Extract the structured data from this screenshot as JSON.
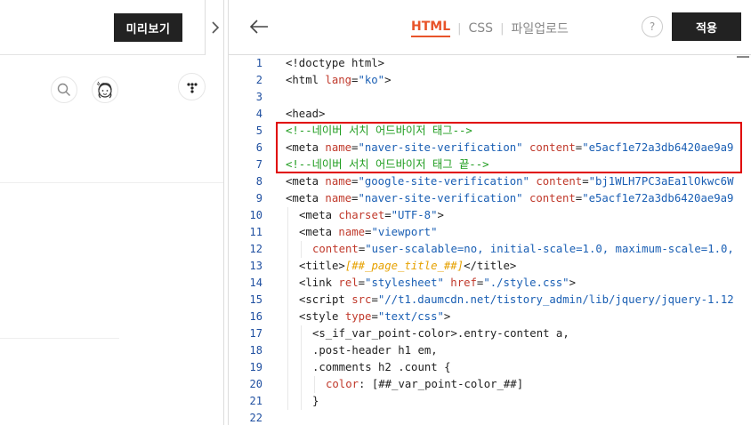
{
  "left": {
    "preview_label": "미리보기"
  },
  "header": {
    "tabs": [
      "HTML",
      "CSS",
      "파일업로드"
    ],
    "help_label": "?",
    "apply_label": "적용"
  },
  "code_lines": [
    {
      "n": "1",
      "indent": 0,
      "parts": [
        [
          "t-tag",
          "<!doctype html>"
        ]
      ]
    },
    {
      "n": "2",
      "indent": 0,
      "parts": [
        [
          "t-tag",
          "<html "
        ],
        [
          "t-attr",
          "lang"
        ],
        [
          "t-tag",
          "="
        ],
        [
          "t-val",
          "\"ko\""
        ],
        [
          "t-tag",
          ">"
        ]
      ]
    },
    {
      "n": "3",
      "indent": 0,
      "parts": []
    },
    {
      "n": "4",
      "indent": 0,
      "parts": [
        [
          "t-tag",
          "<head>"
        ]
      ]
    },
    {
      "n": "5",
      "indent": 0,
      "parts": [
        [
          "t-cmt",
          "<!--네이버 서치 어드바이저 태그-->"
        ]
      ]
    },
    {
      "n": "6",
      "indent": 0,
      "parts": [
        [
          "t-tag",
          "<meta "
        ],
        [
          "t-attr",
          "name"
        ],
        [
          "t-tag",
          "="
        ],
        [
          "t-val",
          "\"naver-site-verification\""
        ],
        [
          "t-tag",
          " "
        ],
        [
          "t-attr",
          "content"
        ],
        [
          "t-tag",
          "="
        ],
        [
          "t-val",
          "\"e5acf1e72a3db6420ae9a9"
        ]
      ]
    },
    {
      "n": "7",
      "indent": 0,
      "parts": [
        [
          "t-cmt",
          "<!--네이버 서치 어드바이저 태그 끝-->"
        ]
      ]
    },
    {
      "n": "8",
      "indent": 0,
      "parts": [
        [
          "t-tag",
          "<meta "
        ],
        [
          "t-attr",
          "name"
        ],
        [
          "t-tag",
          "="
        ],
        [
          "t-val",
          "\"google-site-verification\""
        ],
        [
          "t-tag",
          " "
        ],
        [
          "t-attr",
          "content"
        ],
        [
          "t-tag",
          "="
        ],
        [
          "t-val",
          "\"bj1WLH7PC3aEa1lOkwc6W"
        ]
      ]
    },
    {
      "n": "9",
      "indent": 0,
      "parts": [
        [
          "t-tag",
          "<meta "
        ],
        [
          "t-attr",
          "name"
        ],
        [
          "t-tag",
          "="
        ],
        [
          "t-val",
          "\"naver-site-verification\""
        ],
        [
          "t-tag",
          " "
        ],
        [
          "t-attr",
          "content"
        ],
        [
          "t-tag",
          "="
        ],
        [
          "t-val",
          "\"e5acf1e72a3db6420ae9a9"
        ]
      ]
    },
    {
      "n": "10",
      "indent": 1,
      "parts": [
        [
          "t-tag",
          "<meta "
        ],
        [
          "t-attr",
          "charset"
        ],
        [
          "t-tag",
          "="
        ],
        [
          "t-val",
          "\"UTF-8\""
        ],
        [
          "t-tag",
          ">"
        ]
      ]
    },
    {
      "n": "11",
      "indent": 1,
      "parts": [
        [
          "t-tag",
          "<meta "
        ],
        [
          "t-attr",
          "name"
        ],
        [
          "t-tag",
          "="
        ],
        [
          "t-val",
          "\"viewport\""
        ]
      ]
    },
    {
      "n": "12",
      "indent": 2,
      "parts": [
        [
          "t-attr",
          "content"
        ],
        [
          "t-tag",
          "="
        ],
        [
          "t-val",
          "\"user-scalable=no, initial-scale=1.0, maximum-scale=1.0,"
        ]
      ]
    },
    {
      "n": "13",
      "indent": 1,
      "parts": [
        [
          "t-tag",
          "<title>"
        ],
        [
          "t-var",
          "[##_page_title_##]"
        ],
        [
          "t-tag",
          "</title>"
        ]
      ]
    },
    {
      "n": "14",
      "indent": 1,
      "parts": [
        [
          "t-tag",
          "<link "
        ],
        [
          "t-attr",
          "rel"
        ],
        [
          "t-tag",
          "="
        ],
        [
          "t-val",
          "\"stylesheet\""
        ],
        [
          "t-tag",
          " "
        ],
        [
          "t-attr",
          "href"
        ],
        [
          "t-tag",
          "="
        ],
        [
          "t-val",
          "\"./style.css\""
        ],
        [
          "t-tag",
          ">"
        ]
      ]
    },
    {
      "n": "15",
      "indent": 1,
      "parts": [
        [
          "t-tag",
          "<script "
        ],
        [
          "t-attr",
          "src"
        ],
        [
          "t-tag",
          "="
        ],
        [
          "t-val",
          "\"//t1.daumcdn.net/tistory_admin/lib/jquery/jquery-1.12"
        ]
      ]
    },
    {
      "n": "16",
      "indent": 1,
      "parts": [
        [
          "t-tag",
          "<style "
        ],
        [
          "t-attr",
          "type"
        ],
        [
          "t-tag",
          "="
        ],
        [
          "t-val",
          "\"text/css\""
        ],
        [
          "t-tag",
          ">"
        ]
      ]
    },
    {
      "n": "17",
      "indent": 2,
      "parts": [
        [
          "t-plain",
          "<s_if_var_point-color>.entry-content a,"
        ]
      ]
    },
    {
      "n": "18",
      "indent": 2,
      "parts": [
        [
          "t-plain",
          ".post-header h1 em,"
        ]
      ]
    },
    {
      "n": "19",
      "indent": 2,
      "parts": [
        [
          "t-plain",
          ".comments h2 .count {"
        ]
      ]
    },
    {
      "n": "20",
      "indent": 3,
      "parts": [
        [
          "t-kw",
          "color"
        ],
        [
          "t-plain",
          ": [##_var_point-color_##]"
        ]
      ]
    },
    {
      "n": "21",
      "indent": 2,
      "parts": [
        [
          "t-plain",
          "}"
        ]
      ]
    },
    {
      "n": "22",
      "indent": 0,
      "parts": []
    }
  ]
}
